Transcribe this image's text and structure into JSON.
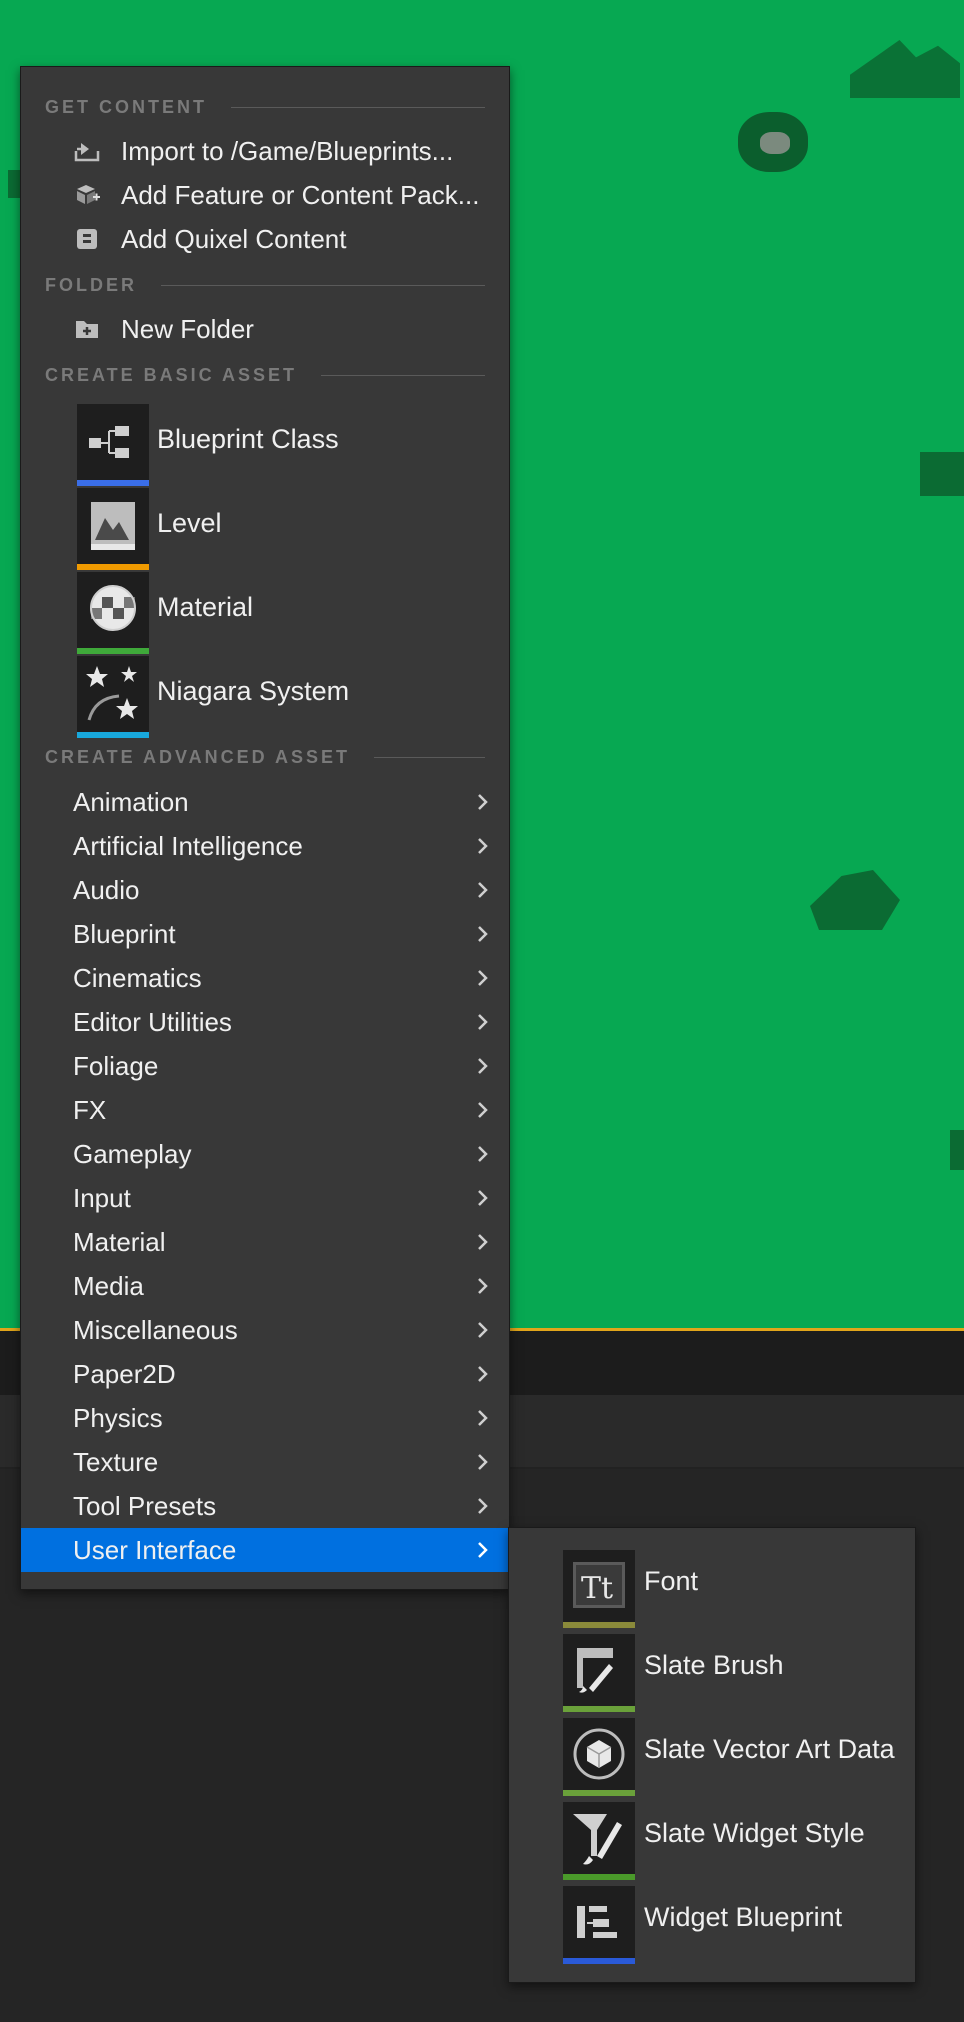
{
  "theme": {
    "viewport_green": "#07a852",
    "menu_bg": "#383838",
    "selected_bg": "#0070e0",
    "accent_yellow": "#e1a51a"
  },
  "menu": {
    "sections": {
      "get_content": "GET CONTENT",
      "folder": "FOLDER",
      "create_basic": "CREATE BASIC ASSET",
      "create_advanced": "CREATE ADVANCED ASSET"
    },
    "get_content_items": [
      {
        "label": "Import to /Game/Blueprints...",
        "icon": "import-icon"
      },
      {
        "label": "Add Feature or Content Pack...",
        "icon": "content-pack-icon"
      },
      {
        "label": "Add Quixel Content",
        "icon": "quixel-icon"
      }
    ],
    "folder_items": [
      {
        "label": "New Folder",
        "icon": "new-folder-icon"
      }
    ],
    "basic_assets": [
      {
        "label": "Blueprint Class",
        "icon": "blueprint-class-icon",
        "color": "#3a6ee8"
      },
      {
        "label": "Level",
        "icon": "level-icon",
        "color": "#f09a00"
      },
      {
        "label": "Material",
        "icon": "material-icon",
        "color": "#3fa93a"
      },
      {
        "label": "Niagara System",
        "icon": "niagara-icon",
        "color": "#18a8dc"
      }
    ],
    "advanced_assets": [
      {
        "label": "Animation"
      },
      {
        "label": "Artificial Intelligence"
      },
      {
        "label": "Audio"
      },
      {
        "label": "Blueprint"
      },
      {
        "label": "Cinematics"
      },
      {
        "label": "Editor Utilities"
      },
      {
        "label": "Foliage"
      },
      {
        "label": "FX"
      },
      {
        "label": "Gameplay"
      },
      {
        "label": "Input"
      },
      {
        "label": "Material"
      },
      {
        "label": "Media"
      },
      {
        "label": "Miscellaneous"
      },
      {
        "label": "Paper2D"
      },
      {
        "label": "Physics"
      },
      {
        "label": "Texture"
      },
      {
        "label": "Tool Presets"
      },
      {
        "label": "User Interface",
        "selected": true
      }
    ]
  },
  "submenu": {
    "items": [
      {
        "label": "Font",
        "icon": "font-icon",
        "color": "#8a8a3a"
      },
      {
        "label": "Slate Brush",
        "icon": "slate-brush-icon",
        "color": "#6aa13a"
      },
      {
        "label": "Slate Vector Art Data",
        "icon": "slate-vector-art-icon",
        "color": "#6aa13a"
      },
      {
        "label": "Slate Widget Style",
        "icon": "slate-widget-style-icon",
        "color": "#4a9a2a"
      },
      {
        "label": "Widget Blueprint",
        "icon": "widget-blueprint-icon",
        "color": "#2a5ad8"
      }
    ]
  }
}
